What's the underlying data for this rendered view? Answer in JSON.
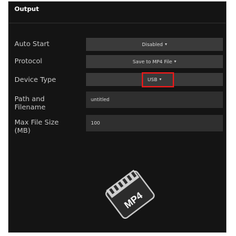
{
  "panel": {
    "title": "Output"
  },
  "fields": {
    "auto_start": {
      "label": "Auto Start",
      "value": "Disabled"
    },
    "protocol": {
      "label": "Protocol",
      "value": "Save to MP4 File"
    },
    "device_type": {
      "label": "Device Type",
      "value": "USB"
    },
    "path": {
      "label": "Path and\nFilename",
      "value": "untitled"
    },
    "max_size": {
      "label": "Max File Size\n(MB)",
      "value": "100"
    }
  },
  "icon": {
    "name": "mp4-file-icon",
    "text": "MP4"
  },
  "colors": {
    "panel_bg": "#141414",
    "control_bg": "#3a3a3a",
    "highlight": "#e01b1b"
  }
}
